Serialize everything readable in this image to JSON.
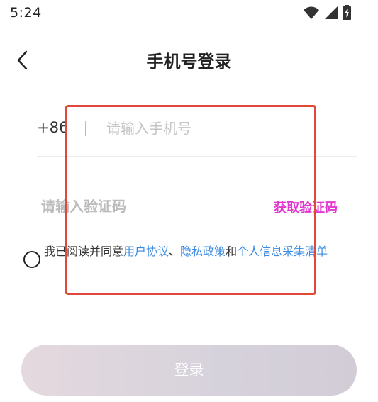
{
  "status_bar": {
    "time": "5:24",
    "icons": [
      "wifi-icon",
      "signal-icon",
      "battery-charging-icon"
    ]
  },
  "header": {
    "back_icon": "chevron-left-icon",
    "title": "手机号登录"
  },
  "phone": {
    "country_code": "+86",
    "placeholder": "请输入手机号",
    "value": ""
  },
  "verification": {
    "placeholder": "请输入验证码",
    "value": "",
    "get_code_label": "获取验证码"
  },
  "agreement": {
    "checked": false,
    "prefix": "我已阅读并同意",
    "user_agreement": "用户协议",
    "sep1": "、",
    "privacy_policy": "隐私政策",
    "sep2": "和",
    "info_list": "个人信息采集清单"
  },
  "login_button": {
    "label": "登录"
  },
  "colors": {
    "accent_pink": "#e23ad0",
    "link_blue": "#3d8be0",
    "highlight_red": "#e0483a",
    "button_bg": "#d6d2db"
  }
}
